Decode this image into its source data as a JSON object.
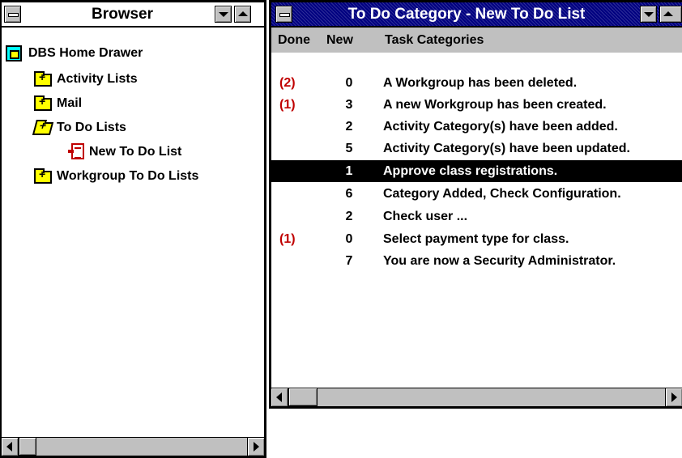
{
  "browser": {
    "title": "Browser",
    "tree": [
      {
        "label": "DBS Home Drawer",
        "icon": "drawer-icon"
      },
      {
        "label": "Activity Lists",
        "icon": "folder-closed-icon"
      },
      {
        "label": "Mail",
        "icon": "folder-closed-icon"
      },
      {
        "label": "To Do Lists",
        "icon": "folder-open-icon"
      },
      {
        "label": "New To Do List",
        "icon": "todo-list-icon"
      },
      {
        "label": "Workgroup To Do Lists",
        "icon": "folder-closed-icon"
      }
    ]
  },
  "todo": {
    "title": "To Do Category - New To Do List",
    "columns": {
      "done": "Done",
      "new": "New",
      "task": "Task Categories"
    },
    "rows": [
      {
        "done": "(2)",
        "new": "0",
        "task": "A Workgroup has been deleted."
      },
      {
        "done": "(1)",
        "new": "3",
        "task": "A new Workgroup has been created."
      },
      {
        "done": "",
        "new": "2",
        "task": "Activity Category(s) have been added."
      },
      {
        "done": "",
        "new": "5",
        "task": "Activity Category(s) have been updated."
      },
      {
        "done": "",
        "new": "1",
        "task": "Approve class registrations.",
        "selected": true
      },
      {
        "done": "",
        "new": "6",
        "task": "Category Added, Check Configuration."
      },
      {
        "done": "",
        "new": "2",
        "task": "Check user ..."
      },
      {
        "done": "(1)",
        "new": "0",
        "task": "Select payment type for class."
      },
      {
        "done": "",
        "new": "7",
        "task": "You are now a Security Administrator."
      }
    ]
  },
  "colors": {
    "active_title": "#000080",
    "done_count": "#c00000",
    "folder": "#ffff00",
    "selection": "#000000"
  }
}
